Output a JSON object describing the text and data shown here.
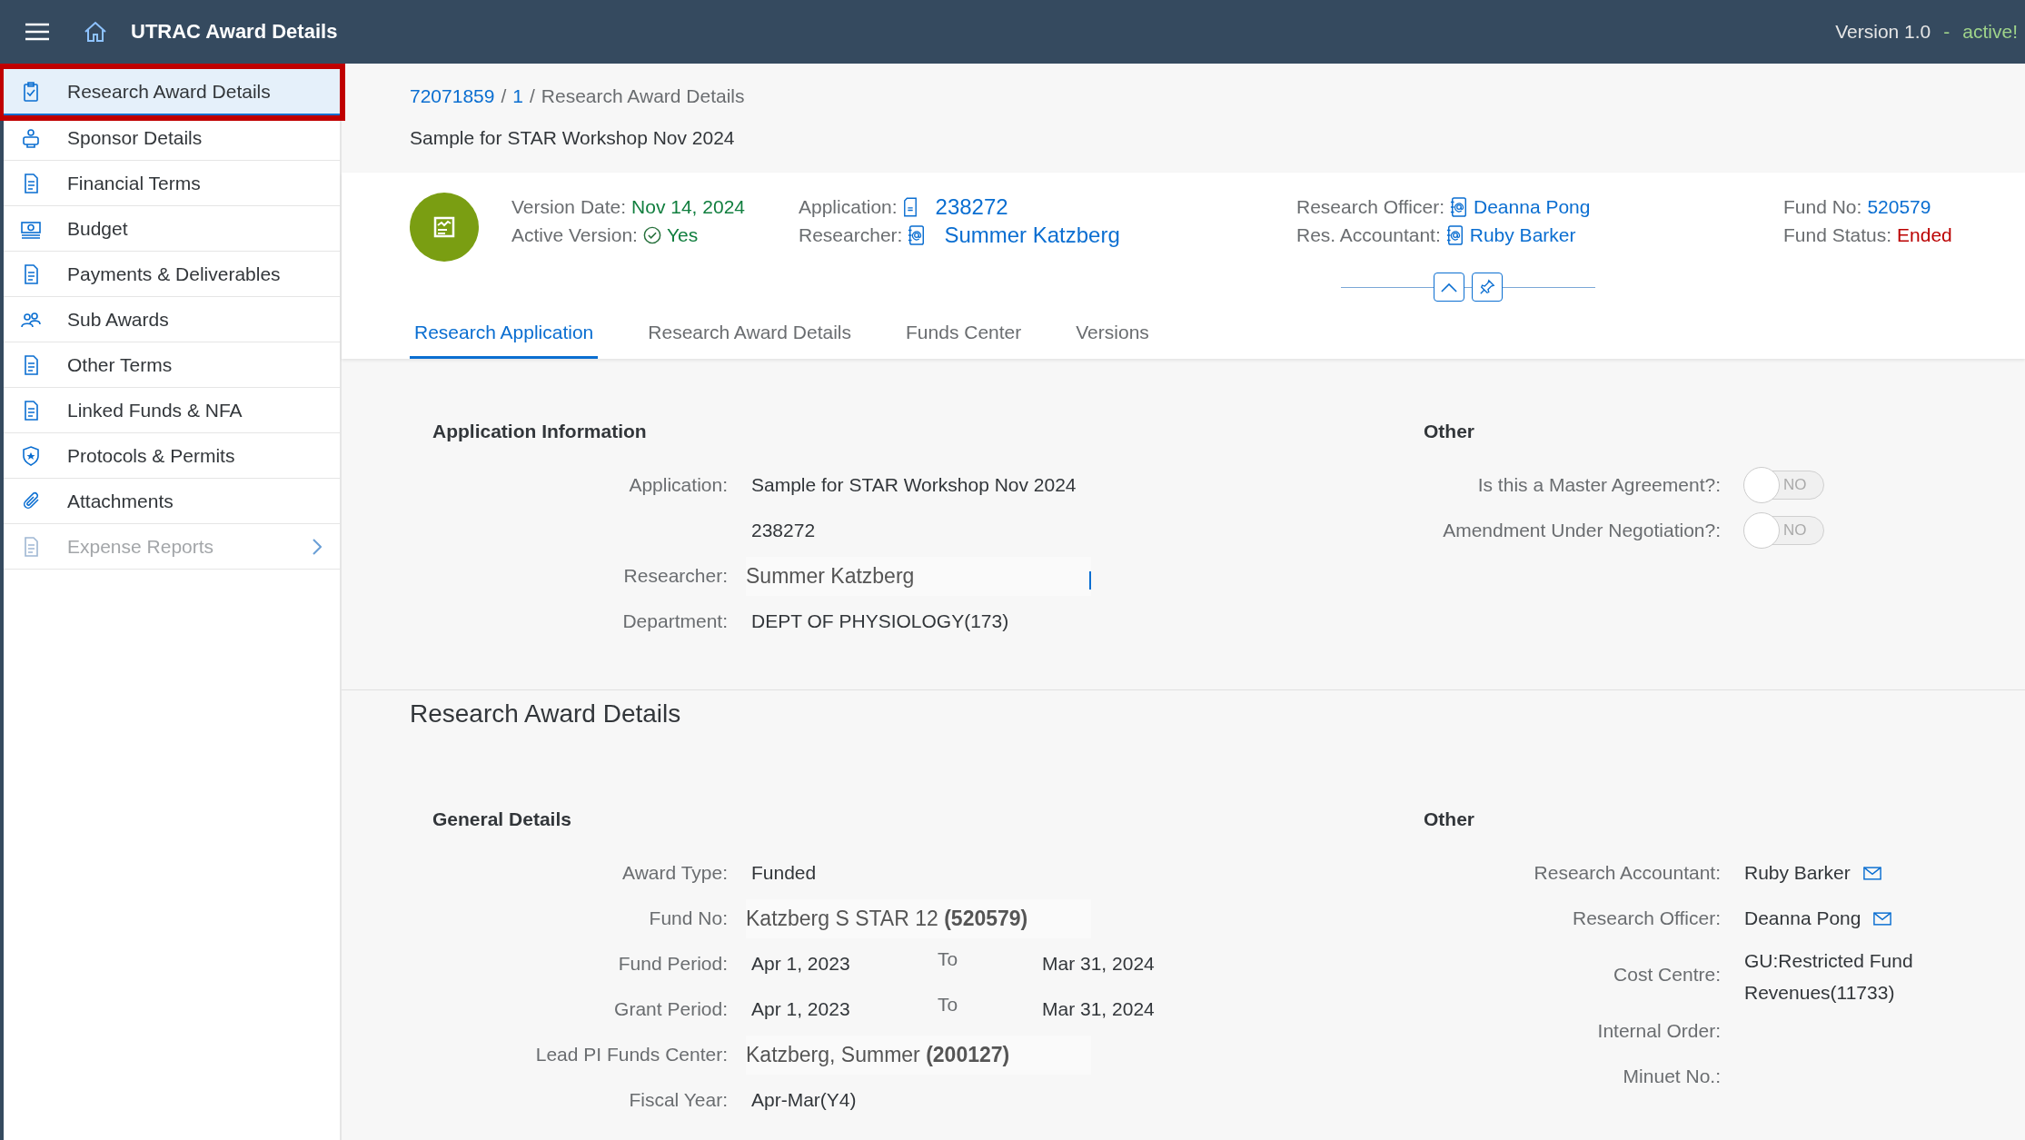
{
  "shell_bar": {
    "title": "UTRAC Award Details",
    "version": "Version 1.0",
    "separator": "-",
    "status": "active!"
  },
  "sidebar": {
    "items": [
      {
        "label": "Research Award Details",
        "selected": true,
        "disabled": false,
        "has_children": false
      },
      {
        "label": "Sponsor Details",
        "selected": false,
        "disabled": false,
        "has_children": false
      },
      {
        "label": "Financial Terms",
        "selected": false,
        "disabled": false,
        "has_children": false
      },
      {
        "label": "Budget",
        "selected": false,
        "disabled": false,
        "has_children": false
      },
      {
        "label": "Payments & Deliverables",
        "selected": false,
        "disabled": false,
        "has_children": false
      },
      {
        "label": "Sub Awards",
        "selected": false,
        "disabled": false,
        "has_children": false
      },
      {
        "label": "Other Terms",
        "selected": false,
        "disabled": false,
        "has_children": false
      },
      {
        "label": "Linked Funds & NFA",
        "selected": false,
        "disabled": false,
        "has_children": false
      },
      {
        "label": "Protocols & Permits",
        "selected": false,
        "disabled": false,
        "has_children": false
      },
      {
        "label": "Attachments",
        "selected": false,
        "disabled": false,
        "has_children": false
      },
      {
        "label": "Expense Reports",
        "selected": false,
        "disabled": true,
        "has_children": true
      }
    ]
  },
  "breadcrumb": {
    "items": [
      {
        "text": "72071859",
        "kind": "link"
      },
      {
        "text": "1",
        "kind": "link"
      },
      {
        "text": "Research Award Details",
        "kind": "current"
      }
    ],
    "separator": "/"
  },
  "subtitle": "Sample for STAR Workshop Nov 2024",
  "object_header": {
    "columns": [
      [
        {
          "label": "Version Date:",
          "value": "Nov 14, 2024",
          "kind": "positive"
        },
        {
          "label": "Active Version:",
          "value": "Yes",
          "kind": "check"
        }
      ],
      [
        {
          "label": "Application:",
          "value": "238272",
          "kind": "doc-link"
        },
        {
          "label": "Researcher:",
          "value": "Summer Katzberg",
          "kind": "contact-link"
        }
      ],
      [
        {
          "label": "Research Officer:",
          "value": "Deanna Pong",
          "kind": "contact-link-small"
        },
        {
          "label": "Res. Accountant:",
          "value": "Ruby Barker",
          "kind": "contact-link-small"
        }
      ],
      [
        {
          "label": "Fund No:",
          "value": "520579",
          "kind": "link"
        },
        {
          "label": "Fund Status:",
          "value": "Ended",
          "kind": "negative"
        }
      ]
    ]
  },
  "tabs": [
    {
      "label": "Research Application",
      "selected": true
    },
    {
      "label": "Research Award Details",
      "selected": false
    },
    {
      "label": "Funds Center",
      "selected": false
    },
    {
      "label": "Versions",
      "selected": false
    }
  ],
  "application_section": {
    "title": "Application Information",
    "fields": [
      {
        "label": "Application:",
        "value": "Sample for STAR Workshop Nov 2024",
        "kind": "text"
      },
      {
        "value": "238272",
        "kind": "text"
      },
      {
        "label": "Researcher:",
        "value": "Summer Katzberg",
        "kind": "input",
        "focused": true
      },
      {
        "label": "Department:",
        "value": "DEPT OF PHYSIOLOGY(173)",
        "kind": "text"
      }
    ],
    "other": {
      "title": "Other",
      "toggles": [
        {
          "label": "Is this a Master Agreement?:",
          "on": false,
          "text": "NO"
        },
        {
          "label": "Amendment Under Negotiation?:",
          "on": false,
          "text": "NO"
        }
      ]
    }
  },
  "award_section": {
    "title": "Research Award Details",
    "general": {
      "title": "General Details",
      "fields": [
        {
          "label": "Award Type:",
          "value": "Funded",
          "kind": "text"
        },
        {
          "label": "Fund No:",
          "value": "Katzberg S STAR 12 **(520579)**",
          "kind": "input"
        },
        {
          "label": "Fund Period:",
          "from": "Apr 1, 2023",
          "to_label": "To",
          "to": "Mar 31, 2024",
          "kind": "period"
        },
        {
          "label": "Grant Period:",
          "from": "Apr 1, 2023",
          "to_label": "To",
          "to": "Mar 31, 2024",
          "kind": "period"
        },
        {
          "label": "Lead PI Funds Center:",
          "value": "Katzberg, Summer **(200127)**",
          "kind": "input"
        },
        {
          "label": "Fiscal Year:",
          "value": "Apr-Mar(Y4)",
          "kind": "text"
        }
      ]
    },
    "other": {
      "title": "Other",
      "fields": [
        {
          "label": "Research Accountant:",
          "value": "Ruby Barker",
          "kind": "contact"
        },
        {
          "label": "Research Officer:",
          "value": "Deanna Pong",
          "kind": "contact"
        },
        {
          "label": "Cost Centre:",
          "value": "GU:Restricted Fund Revenues(11733)",
          "kind": "text"
        },
        {
          "label": "Internal Order:",
          "kind": "empty"
        },
        {
          "label": "Minuet No.:",
          "kind": "empty"
        }
      ]
    }
  }
}
